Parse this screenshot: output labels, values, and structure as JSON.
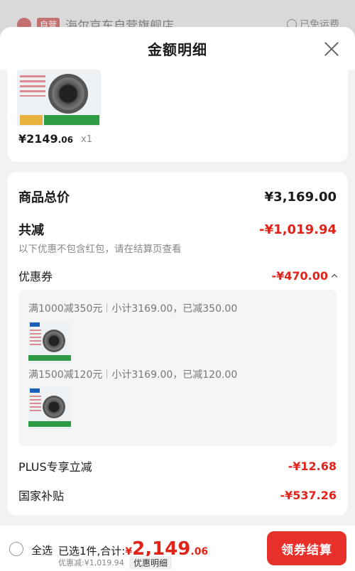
{
  "store": {
    "tag": "自营",
    "name": "海尔京东自营旗舰店",
    "shipping": "已免运费"
  },
  "sheet": {
    "title": "金额明细"
  },
  "product": {
    "price_int": "¥2149",
    "price_dec": ".06",
    "qty": "x1"
  },
  "details": {
    "total_label": "商品总价",
    "total_value": "¥3,169.00",
    "reduce_label": "共减",
    "reduce_value": "-¥1,019.94",
    "note": "以下优惠不包含红包，请在结算页查看",
    "coupon_label": "优惠券",
    "coupon_value": "-¥470.00",
    "coupons": [
      {
        "rule": "满1000减350元",
        "detail": "小计3169.00，已减350.00"
      },
      {
        "rule": "满1500减120元",
        "detail": "小计3169.00，已减120.00"
      }
    ],
    "plus_label": "PLUS专享立减",
    "plus_value": "-¥12.68",
    "gov_label": "国家补贴",
    "gov_value": "-¥537.26"
  },
  "bottom": {
    "select_all": "全选",
    "selected": "已选1件,合计:",
    "currency": "¥",
    "total_int": "2,149",
    "total_dec": ".06",
    "saved": "优惠减:¥1,019.94",
    "detail_btn": "优惠明细",
    "checkout": "领券结算"
  },
  "colors": {
    "accent_red": "#e2231a",
    "checkout_bg": "#e8302b"
  }
}
